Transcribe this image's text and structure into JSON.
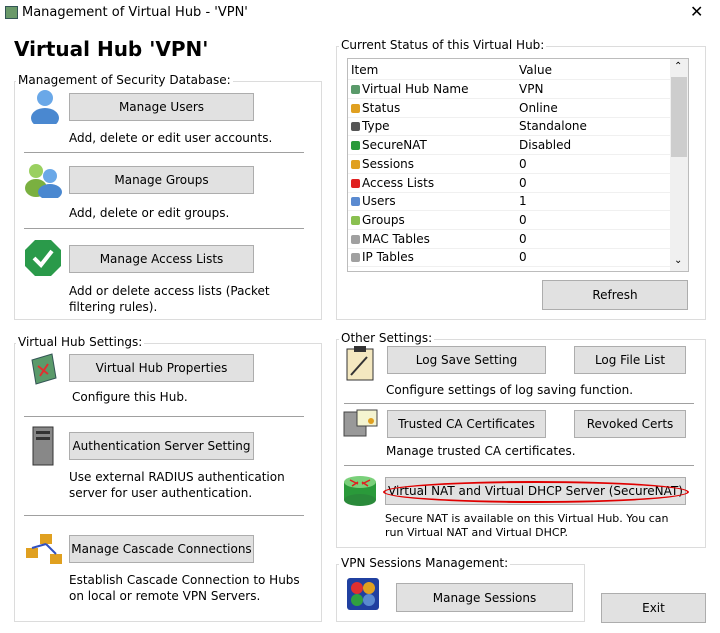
{
  "window": {
    "title": "Management of Virtual Hub - 'VPN'",
    "close": "✕"
  },
  "heading": "Virtual Hub 'VPN'",
  "security": {
    "label": "Management of Security Database:",
    "users_btn": "Manage Users",
    "users_desc": "Add, delete or edit user accounts.",
    "groups_btn": "Manage Groups",
    "groups_desc": "Add, delete or edit groups.",
    "acl_btn": "Manage Access Lists",
    "acl_desc": "Add or delete access lists (Packet filtering rules)."
  },
  "hub": {
    "label": "Virtual Hub Settings:",
    "props_btn": "Virtual Hub Properties",
    "props_desc": "Configure this Hub.",
    "auth_btn": "Authentication Server Setting",
    "auth_desc": "Use external RADIUS authentication server for user authentication.",
    "cascade_btn": "Manage Cascade Connections",
    "cascade_desc": "Establish Cascade Connection to Hubs on local or remote VPN Servers."
  },
  "status": {
    "label": "Current Status of this Virtual Hub:",
    "col_item": "Item",
    "col_value": "Value",
    "rows": [
      {
        "item": "Virtual Hub Name",
        "value": "VPN",
        "icon": "hub-icon",
        "color": "#5a9a6a"
      },
      {
        "item": "Status",
        "value": "Online",
        "icon": "status-icon",
        "color": "#e0a020"
      },
      {
        "item": "Type",
        "value": "Standalone",
        "icon": "server-icon",
        "color": "#555555"
      },
      {
        "item": "SecureNAT",
        "value": "Disabled",
        "icon": "securenat-icon",
        "color": "#2a9a3a"
      },
      {
        "item": "Sessions",
        "value": "0",
        "icon": "sessions-icon",
        "color": "#e0a020"
      },
      {
        "item": "Access Lists",
        "value": "0",
        "icon": "access-list-icon",
        "color": "#e02020"
      },
      {
        "item": "Users",
        "value": "1",
        "icon": "user-icon",
        "color": "#5a8ad0"
      },
      {
        "item": "Groups",
        "value": "0",
        "icon": "group-icon",
        "color": "#8ac050"
      },
      {
        "item": "MAC Tables",
        "value": "0",
        "icon": "mac-table-icon",
        "color": "#a0a0a0"
      },
      {
        "item": "IP Tables",
        "value": "0",
        "icon": "ip-table-icon",
        "color": "#a0a0a0"
      }
    ],
    "refresh": "Refresh"
  },
  "other": {
    "label": "Other Settings:",
    "log_save": "Log Save Setting",
    "log_list": "Log File List",
    "log_desc": "Configure settings of log saving function.",
    "ca": "Trusted CA Certificates",
    "revoked": "Revoked Certs",
    "ca_desc": "Manage trusted CA certificates.",
    "nat": "Virtual NAT and Virtual DHCP Server (SecureNAT)",
    "nat_desc": "Secure NAT is available on this Virtual Hub. You can run Virtual NAT and Virtual DHCP.",
    "highlight": "#e00000"
  },
  "sessions": {
    "label": "VPN Sessions Management:",
    "btn": "Manage Sessions"
  },
  "exit": "Exit"
}
